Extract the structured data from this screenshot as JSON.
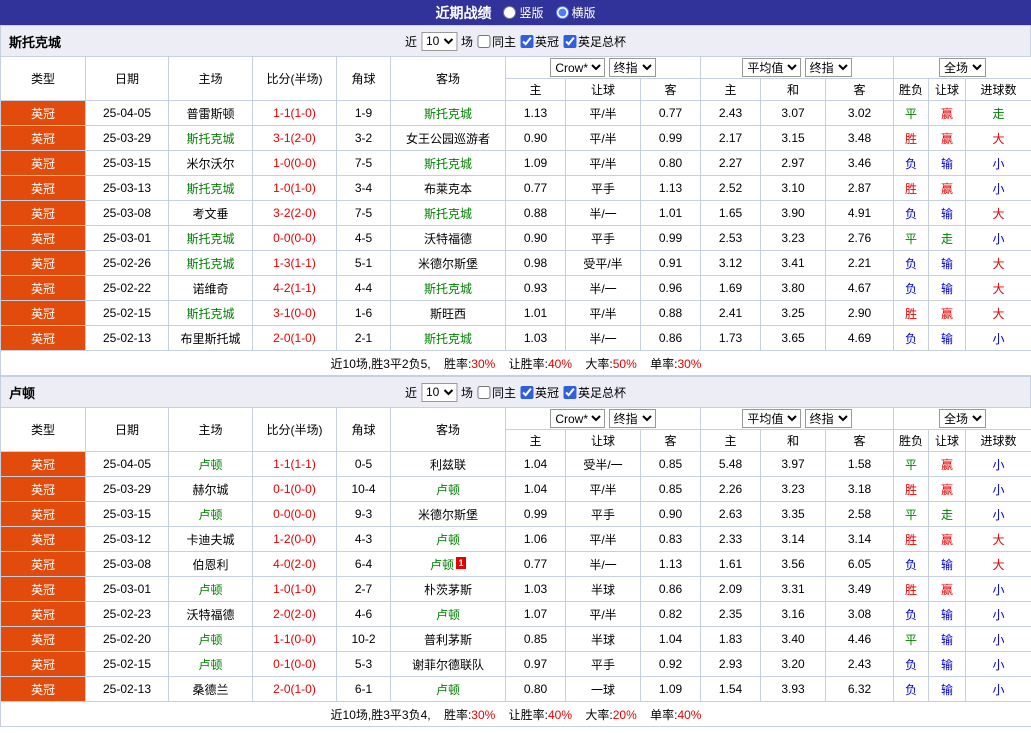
{
  "title_bar": {
    "title": "近期战绩",
    "view_options": [
      {
        "label": "竖版",
        "selected": false
      },
      {
        "label": "横版",
        "selected": true
      }
    ]
  },
  "filters": {
    "near_label": "近",
    "matches_count": "10",
    "matches_label": "场",
    "checkboxes": [
      {
        "label": "同主",
        "checked": false
      },
      {
        "label": "英冠",
        "checked": true
      },
      {
        "label": "英足总杯",
        "checked": true
      }
    ]
  },
  "table_header": {
    "main_cols": [
      "类型",
      "日期",
      "主场",
      "比分(半场)",
      "角球",
      "客场"
    ],
    "bookmaker": "Crow*",
    "odds_time": "终指",
    "average": "平均值",
    "average_time": "终指",
    "scope": "全场",
    "sub_cols": [
      "主",
      "让球",
      "客",
      "主",
      "和",
      "客",
      "胜负",
      "让球",
      "进球数"
    ]
  },
  "colors": {
    "accent_navy": "#32329b",
    "league_badge": "#e24b0c",
    "focal_team_green": "#008000",
    "win_red": "#e60000",
    "draw_green": "#008000",
    "loss_blue": "#0000cc",
    "header_bg": "#ededf6"
  },
  "sections": [
    {
      "team": "斯托克城",
      "rows": [
        {
          "league": "英冠",
          "date": "25-04-05",
          "home": "普雷斯顿",
          "home_focal": false,
          "score": "1-1(1-0)",
          "corners": "1-9",
          "away": "斯托克城",
          "away_focal": true,
          "odds": [
            "1.13",
            "平/半",
            "0.77"
          ],
          "avg": [
            "2.43",
            "3.07",
            "3.02"
          ],
          "result": "平",
          "handicap_result": "赢",
          "goals_result": "走"
        },
        {
          "league": "英冠",
          "date": "25-03-29",
          "home": "斯托克城",
          "home_focal": true,
          "score": "3-1(2-0)",
          "corners": "3-2",
          "away": "女王公园巡游者",
          "away_focal": false,
          "odds": [
            "0.90",
            "平/半",
            "0.99"
          ],
          "avg": [
            "2.17",
            "3.15",
            "3.48"
          ],
          "result": "胜",
          "handicap_result": "赢",
          "goals_result": "大"
        },
        {
          "league": "英冠",
          "date": "25-03-15",
          "home": "米尔沃尔",
          "home_focal": false,
          "score": "1-0(0-0)",
          "corners": "7-5",
          "away": "斯托克城",
          "away_focal": true,
          "odds": [
            "1.09",
            "平/半",
            "0.80"
          ],
          "avg": [
            "2.27",
            "2.97",
            "3.46"
          ],
          "result": "负",
          "handicap_result": "输",
          "goals_result": "小"
        },
        {
          "league": "英冠",
          "date": "25-03-13",
          "home": "斯托克城",
          "home_focal": true,
          "score": "1-0(1-0)",
          "corners": "3-4",
          "away": "布莱克本",
          "away_focal": false,
          "odds": [
            "0.77",
            "平手",
            "1.13"
          ],
          "avg": [
            "2.52",
            "3.10",
            "2.87"
          ],
          "result": "胜",
          "handicap_result": "赢",
          "goals_result": "小"
        },
        {
          "league": "英冠",
          "date": "25-03-08",
          "home": "考文垂",
          "home_focal": false,
          "score": "3-2(2-0)",
          "corners": "7-5",
          "away": "斯托克城",
          "away_focal": true,
          "odds": [
            "0.88",
            "半/一",
            "1.01"
          ],
          "avg": [
            "1.65",
            "3.90",
            "4.91"
          ],
          "result": "负",
          "handicap_result": "输",
          "goals_result": "大"
        },
        {
          "league": "英冠",
          "date": "25-03-01",
          "home": "斯托克城",
          "home_focal": true,
          "score": "0-0(0-0)",
          "corners": "4-5",
          "away": "沃特福德",
          "away_focal": false,
          "odds": [
            "0.90",
            "平手",
            "0.99"
          ],
          "avg": [
            "2.53",
            "3.23",
            "2.76"
          ],
          "result": "平",
          "handicap_result": "走",
          "goals_result": "小"
        },
        {
          "league": "英冠",
          "date": "25-02-26",
          "home": "斯托克城",
          "home_focal": true,
          "score": "1-3(1-1)",
          "corners": "5-1",
          "away": "米德尔斯堡",
          "away_focal": false,
          "odds": [
            "0.98",
            "受平/半",
            "0.91"
          ],
          "avg": [
            "3.12",
            "3.41",
            "2.21"
          ],
          "result": "负",
          "handicap_result": "输",
          "goals_result": "大"
        },
        {
          "league": "英冠",
          "date": "25-02-22",
          "home": "诺维奇",
          "home_focal": false,
          "score": "4-2(1-1)",
          "corners": "4-4",
          "away": "斯托克城",
          "away_focal": true,
          "odds": [
            "0.93",
            "半/一",
            "0.96"
          ],
          "avg": [
            "1.69",
            "3.80",
            "4.67"
          ],
          "result": "负",
          "handicap_result": "输",
          "goals_result": "大"
        },
        {
          "league": "英冠",
          "date": "25-02-15",
          "home": "斯托克城",
          "home_focal": true,
          "score": "3-1(0-0)",
          "corners": "1-6",
          "away": "斯旺西",
          "away_focal": false,
          "odds": [
            "1.01",
            "平/半",
            "0.88"
          ],
          "avg": [
            "2.41",
            "3.25",
            "2.90"
          ],
          "result": "胜",
          "handicap_result": "赢",
          "goals_result": "大"
        },
        {
          "league": "英冠",
          "date": "25-02-13",
          "home": "布里斯托城",
          "home_focal": false,
          "score": "2-0(1-0)",
          "corners": "2-1",
          "away": "斯托克城",
          "away_focal": true,
          "odds": [
            "1.03",
            "半/一",
            "0.86"
          ],
          "avg": [
            "1.73",
            "3.65",
            "4.69"
          ],
          "result": "负",
          "handicap_result": "输",
          "goals_result": "小"
        }
      ],
      "summary": {
        "prefix": "近10场,胜3平2负5,",
        "stats": [
          {
            "label": "胜率:",
            "value": "30%"
          },
          {
            "label": "让胜率:",
            "value": "40%"
          },
          {
            "label": "大率:",
            "value": "50%"
          },
          {
            "label": "单率:",
            "value": "30%"
          }
        ]
      }
    },
    {
      "team": "卢顿",
      "rows": [
        {
          "league": "英冠",
          "date": "25-04-05",
          "home": "卢顿",
          "home_focal": true,
          "score": "1-1(1-1)",
          "corners": "0-5",
          "away": "利兹联",
          "away_focal": false,
          "odds": [
            "1.04",
            "受半/一",
            "0.85"
          ],
          "avg": [
            "5.48",
            "3.97",
            "1.58"
          ],
          "result": "平",
          "handicap_result": "赢",
          "goals_result": "小"
        },
        {
          "league": "英冠",
          "date": "25-03-29",
          "home": "赫尔城",
          "home_focal": false,
          "score": "0-1(0-0)",
          "corners": "10-4",
          "away": "卢顿",
          "away_focal": true,
          "odds": [
            "1.04",
            "平/半",
            "0.85"
          ],
          "avg": [
            "2.26",
            "3.23",
            "3.18"
          ],
          "result": "胜",
          "handicap_result": "赢",
          "goals_result": "小"
        },
        {
          "league": "英冠",
          "date": "25-03-15",
          "home": "卢顿",
          "home_focal": true,
          "score": "0-0(0-0)",
          "corners": "9-3",
          "away": "米德尔斯堡",
          "away_focal": false,
          "odds": [
            "0.99",
            "平手",
            "0.90"
          ],
          "avg": [
            "2.63",
            "3.35",
            "2.58"
          ],
          "result": "平",
          "handicap_result": "走",
          "goals_result": "小"
        },
        {
          "league": "英冠",
          "date": "25-03-12",
          "home": "卡迪夫城",
          "home_focal": false,
          "score": "1-2(0-0)",
          "corners": "4-3",
          "away": "卢顿",
          "away_focal": true,
          "odds": [
            "1.06",
            "平/半",
            "0.83"
          ],
          "avg": [
            "2.33",
            "3.14",
            "3.14"
          ],
          "result": "胜",
          "handicap_result": "赢",
          "goals_result": "大"
        },
        {
          "league": "英冠",
          "date": "25-03-08",
          "home": "伯恩利",
          "home_focal": false,
          "score": "4-0(2-0)",
          "corners": "6-4",
          "away": "卢顿",
          "away_focal": true,
          "away_badge": "1",
          "odds": [
            "0.77",
            "半/一",
            "1.13"
          ],
          "avg": [
            "1.61",
            "3.56",
            "6.05"
          ],
          "result": "负",
          "handicap_result": "输",
          "goals_result": "大"
        },
        {
          "league": "英冠",
          "date": "25-03-01",
          "home": "卢顿",
          "home_focal": true,
          "score": "1-0(1-0)",
          "corners": "2-7",
          "away": "朴茨茅斯",
          "away_focal": false,
          "odds": [
            "1.03",
            "半球",
            "0.86"
          ],
          "avg": [
            "2.09",
            "3.31",
            "3.49"
          ],
          "result": "胜",
          "handicap_result": "赢",
          "goals_result": "小"
        },
        {
          "league": "英冠",
          "date": "25-02-23",
          "home": "沃特福德",
          "home_focal": false,
          "score": "2-0(2-0)",
          "corners": "4-6",
          "away": "卢顿",
          "away_focal": true,
          "odds": [
            "1.07",
            "平/半",
            "0.82"
          ],
          "avg": [
            "2.35",
            "3.16",
            "3.08"
          ],
          "result": "负",
          "handicap_result": "输",
          "goals_result": "小"
        },
        {
          "league": "英冠",
          "date": "25-02-20",
          "home": "卢顿",
          "home_focal": true,
          "score": "1-1(0-0)",
          "corners": "10-2",
          "away": "普利茅斯",
          "away_focal": false,
          "odds": [
            "0.85",
            "半球",
            "1.04"
          ],
          "avg": [
            "1.83",
            "3.40",
            "4.46"
          ],
          "result": "平",
          "handicap_result": "输",
          "goals_result": "小"
        },
        {
          "league": "英冠",
          "date": "25-02-15",
          "home": "卢顿",
          "home_focal": true,
          "score": "0-1(0-0)",
          "corners": "5-3",
          "away": "谢菲尔德联队",
          "away_focal": false,
          "odds": [
            "0.97",
            "平手",
            "0.92"
          ],
          "avg": [
            "2.93",
            "3.20",
            "2.43"
          ],
          "result": "负",
          "handicap_result": "输",
          "goals_result": "小"
        },
        {
          "league": "英冠",
          "date": "25-02-13",
          "home": "桑德兰",
          "home_focal": false,
          "score": "2-0(1-0)",
          "corners": "6-1",
          "away": "卢顿",
          "away_focal": true,
          "odds": [
            "0.80",
            "一球",
            "1.09"
          ],
          "avg": [
            "1.54",
            "3.93",
            "6.32"
          ],
          "result": "负",
          "handicap_result": "输",
          "goals_result": "小"
        }
      ],
      "summary": {
        "prefix": "近10场,胜3平3负4,",
        "stats": [
          {
            "label": "胜率:",
            "value": "30%"
          },
          {
            "label": "让胜率:",
            "value": "40%"
          },
          {
            "label": "大率:",
            "value": "20%"
          },
          {
            "label": "单率:",
            "value": "40%"
          }
        ]
      }
    }
  ]
}
